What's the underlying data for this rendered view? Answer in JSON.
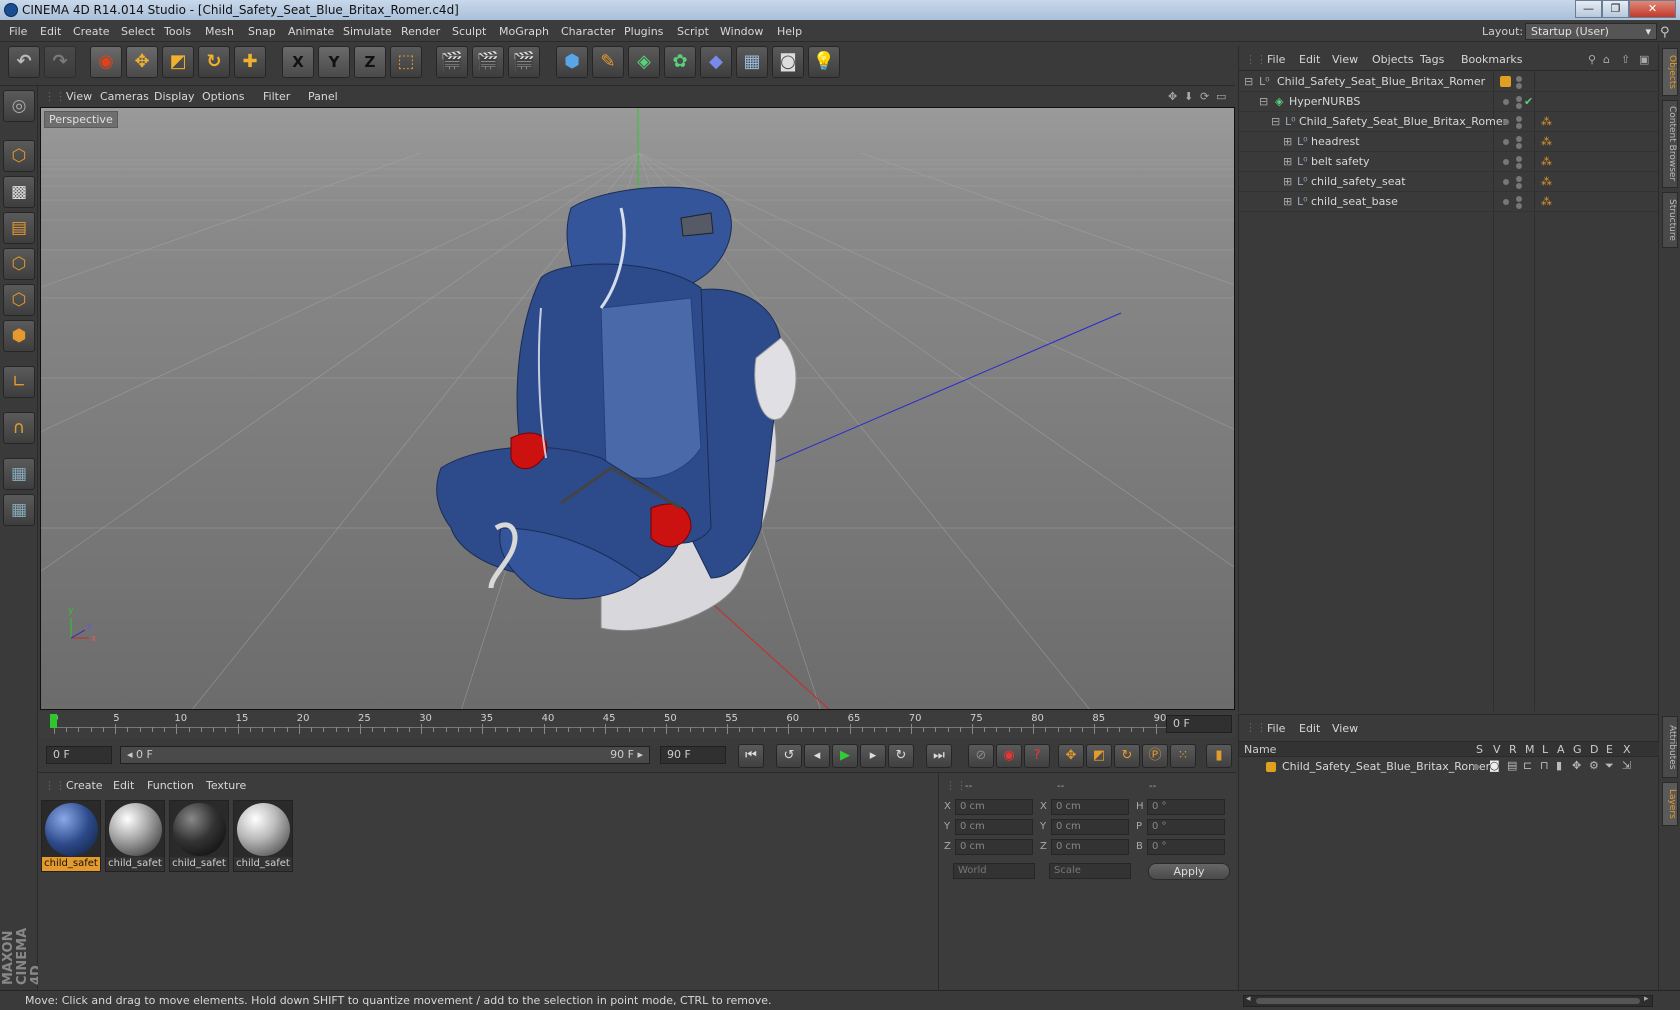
{
  "window": {
    "title": "CINEMA 4D R14.014 Studio - [Child_Safety_Seat_Blue_Britax_Romer.c4d]",
    "controls": [
      "—",
      "❐",
      "✕"
    ]
  },
  "menubar": {
    "items": [
      "File",
      "Edit",
      "Create",
      "Select",
      "Tools",
      "Mesh",
      "Snap",
      "Animate",
      "Simulate",
      "Render",
      "Sculpt",
      "MoGraph",
      "Character",
      "Plugins",
      "Script",
      "Window",
      "Help"
    ],
    "layout_label": "Layout:",
    "layout_value": "Startup (User)"
  },
  "toolbar": {
    "axis_x": "X",
    "axis_y": "Y",
    "axis_z": "Z"
  },
  "viewport": {
    "menu": [
      "View",
      "Cameras",
      "Display",
      "Options",
      "Filter",
      "Panel"
    ],
    "label": "Perspective",
    "axis_y": "y",
    "axis_z": "z",
    "axis_x": "x"
  },
  "timeline": {
    "ticks": [
      "0",
      "5",
      "10",
      "15",
      "20",
      "25",
      "30",
      "35",
      "40",
      "45",
      "50",
      "55",
      "60",
      "65",
      "70",
      "75",
      "80",
      "85",
      "90"
    ],
    "current_frame": "0 F"
  },
  "controls": {
    "start_frame": "0 F",
    "range_start": "◂ 0 F",
    "range_end": "90 F ▸",
    "end_frame": "90 F"
  },
  "materials": {
    "menu": [
      "Create",
      "Edit",
      "Function",
      "Texture"
    ],
    "items": [
      {
        "label": "child_safet",
        "selected": true
      },
      {
        "label": "child_safet",
        "selected": false
      },
      {
        "label": "child_safet",
        "selected": false
      },
      {
        "label": "child_safet",
        "selected": false
      }
    ]
  },
  "coordinates": {
    "header": [
      "--",
      "--",
      "--"
    ],
    "rows": [
      {
        "a": "X",
        "a_val": "0 cm",
        "b": "X",
        "b_val": "0 cm",
        "c": "H",
        "c_val": "0 °"
      },
      {
        "a": "Y",
        "a_val": "0 cm",
        "b": "Y",
        "b_val": "0 cm",
        "c": "P",
        "c_val": "0 °"
      },
      {
        "a": "Z",
        "a_val": "0 cm",
        "b": "Z",
        "b_val": "0 cm",
        "c": "B",
        "c_val": "0 °"
      }
    ],
    "mode": "World",
    "scale": "Scale",
    "apply": "Apply"
  },
  "objects": {
    "menu": [
      "File",
      "Edit",
      "View",
      "Objects",
      "Tags",
      "Bookmarks"
    ],
    "tree": [
      {
        "name": "Child_Safety_Seat_Blue_Britax_Romer",
        "depth": 0
      },
      {
        "name": "HyperNURBS",
        "depth": 1
      },
      {
        "name": "Child_Safety_Seat_Blue_Britax_Romer",
        "depth": 2
      },
      {
        "name": "headrest",
        "depth": 3
      },
      {
        "name": "belt safety",
        "depth": 3
      },
      {
        "name": "child_safety_seat",
        "depth": 3
      },
      {
        "name": "child_seat_base",
        "depth": 3
      }
    ]
  },
  "layers": {
    "menu": [
      "File",
      "Edit",
      "View"
    ],
    "columns": [
      "Name",
      "S",
      "V",
      "R",
      "M",
      "L",
      "A",
      "G",
      "D",
      "E",
      "X"
    ],
    "row": "Child_Safety_Seat_Blue_Britax_Romer"
  },
  "side_tabs": [
    "Objects",
    "Content Browser",
    "Structure",
    "Attributes",
    "Layers"
  ],
  "brand": "MAXON CINEMA 4D",
  "status": "Move: Click and drag to move elements. Hold down SHIFT to quantize movement / add to the selection in point mode, CTRL to remove.",
  "colors": {
    "accent": "#e49a2c",
    "seat_blue": "#2d4a8a",
    "seat_red": "#cc1111"
  }
}
